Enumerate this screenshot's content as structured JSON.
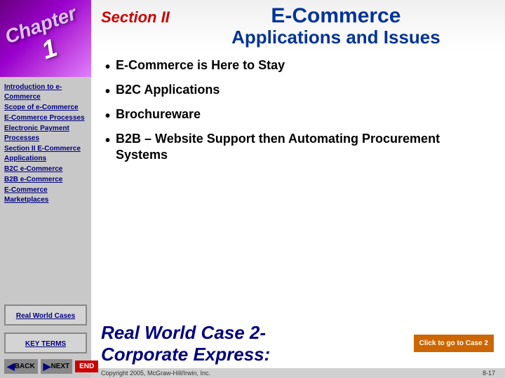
{
  "sidebar": {
    "chapter_label": "Chapter",
    "chapter_num": "1",
    "nav_items": [
      {
        "id": "intro",
        "label": "Introduction to e-Commerce"
      },
      {
        "id": "scope",
        "label": "Scope of e-Commerce"
      },
      {
        "id": "ecommerce",
        "label": "E-Commerce Processes"
      },
      {
        "id": "electronic",
        "label": "Electronic Payment Processes"
      },
      {
        "id": "section2",
        "label": "Section II E-Commerce Applications"
      },
      {
        "id": "b2c",
        "label": "B2C e-Commerce"
      },
      {
        "id": "b2b",
        "label": "B2B e-Commerce"
      },
      {
        "id": "marketplaces",
        "label": "E-Commerce Marketplaces"
      }
    ],
    "real_world_label": "Real World Cases",
    "key_terms_label": "KEY TERMS",
    "back_label": "BACK",
    "next_label": "NEXT",
    "end_label": "END"
  },
  "header": {
    "section_label": "Section II",
    "title_line1": "E-Commerce",
    "title_line2": "Applications and Issues"
  },
  "content": {
    "bullets": [
      "E-Commerce is Here to Stay",
      "B2C Applications",
      "Brochureware",
      "B2B – Website Support then Automating Procurement Systems"
    ]
  },
  "real_world_case": {
    "text_line1": "Real World Case 2-",
    "text_line2": "Corporate Express:",
    "click_label": "Click to go to Case 2"
  },
  "footer": {
    "left": "Copyright 2005, McGraw-Hill/Irwin, Inc.",
    "right": "8-17"
  }
}
